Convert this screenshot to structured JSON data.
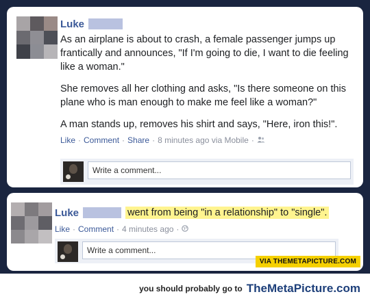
{
  "post1": {
    "author": "Luke",
    "paragraphs": [
      "As an airplane is about to crash, a female passenger jumps up frantically and announces, \"If I'm going to die, I want to die feeling like a woman.\"",
      "She removes all her clothing and asks, \"Is there someone on this plane who is man enough to make me feel like a woman?\"",
      "A man stands up, removes his shirt and says, \"Here, iron this!\"."
    ],
    "like_label": "Like",
    "comment_label": "Comment",
    "share_label": "Share",
    "timestamp": "8 minutes ago via Mobile",
    "separator": "·",
    "comment_placeholder": "Write a comment..."
  },
  "post2": {
    "author": "Luke",
    "status": "went from being \"in a relationship\" to \"single\".",
    "like_label": "Like",
    "comment_label": "Comment",
    "timestamp": "4 minutes ago",
    "separator": "·",
    "comment_placeholder": "Write a comment..."
  },
  "avatar_colors": [
    "#a8a4a6",
    "#5e5a5e",
    "#9a8a86",
    "#6b6a70",
    "#8f8e94",
    "#4d4f57",
    "#3f4149",
    "#8c8d94",
    "#b7b5b8"
  ],
  "avatar2_colors": [
    "#b3aeb0",
    "#7d7a7e",
    "#a29c9f",
    "#6e6c72",
    "#9d9a9e",
    "#5f5e64",
    "#8b898d",
    "#a9a6a9",
    "#c2bfc1"
  ],
  "watermark": "VIA THEMETAPICTURE.COM",
  "footer": {
    "prefix": "you should probably go to",
    "brand": "TheMetaPicture.com"
  }
}
